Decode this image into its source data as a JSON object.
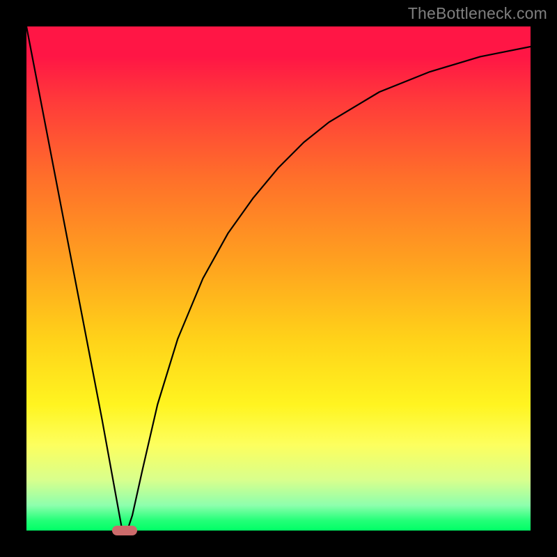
{
  "watermark": "TheBottleneck.com",
  "chart_data": {
    "type": "line",
    "title": "",
    "xlabel": "",
    "ylabel": "",
    "xlim": [
      0,
      100
    ],
    "ylim": [
      0,
      100
    ],
    "series": [
      {
        "name": "curve",
        "x": [
          0,
          5,
          10,
          15,
          19,
          20,
          21,
          23,
          26,
          30,
          35,
          40,
          45,
          50,
          55,
          60,
          65,
          70,
          75,
          80,
          85,
          90,
          95,
          100
        ],
        "values": [
          100,
          74,
          48,
          22,
          0,
          0,
          3,
          12,
          25,
          38,
          50,
          59,
          66,
          72,
          77,
          81,
          84,
          87,
          89,
          91,
          92.5,
          94,
          95,
          96
        ]
      }
    ],
    "marker": {
      "x": 19.5,
      "y": 0,
      "color": "#cc6b6b"
    },
    "gradient_stops": [
      {
        "pos": 0.0,
        "color": "#ff1645"
      },
      {
        "pos": 0.5,
        "color": "#ffbb1a"
      },
      {
        "pos": 0.8,
        "color": "#fff94b"
      },
      {
        "pos": 1.0,
        "color": "#00ff66"
      }
    ]
  }
}
